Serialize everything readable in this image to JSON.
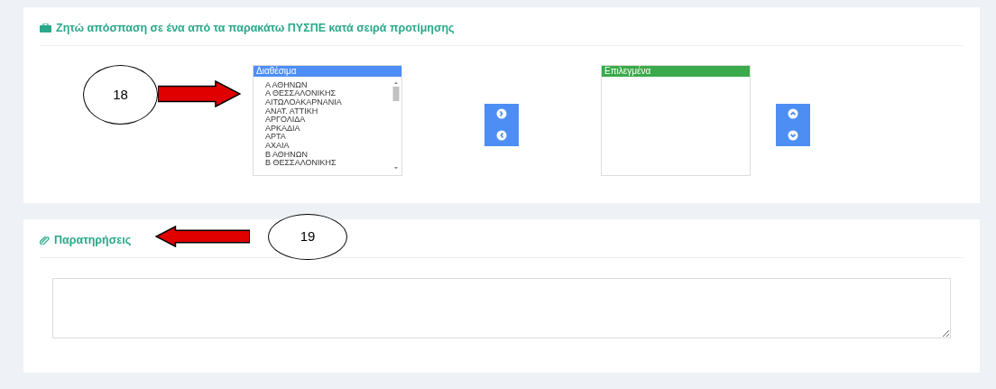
{
  "preferences": {
    "title": "Ζητώ απόσπαση σε ένα από τα παρακάτω ΠΥΣΠΕ κατά σειρά προτίμησης",
    "available": {
      "header": "Διαθέσιμα",
      "items": [
        "Α ΑΘΗΝΩΝ",
        "Α ΘΕΣΣΑΛΟΝΙΚΗΣ",
        "ΑΙΤΩΛΟΑΚΑΡΝΑΝΙΑ",
        "ΑΝΑΤ. ΑΤΤΙΚΗ",
        "ΑΡΓΟΛΙΔΑ",
        "ΑΡΚΑΔΙΑ",
        "ΑΡΤΑ",
        "ΑΧΑΙΑ",
        "Β ΑΘΗΝΩΝ",
        "Β ΘΕΣΣΑΛΟΝΙΚΗΣ"
      ]
    },
    "chosen": {
      "header": "Επιλεγμένα"
    }
  },
  "remarks": {
    "title": "Παρατηρήσεις"
  },
  "callouts": [
    {
      "label": "18",
      "kind": "right"
    },
    {
      "label": "19",
      "kind": "left"
    }
  ]
}
